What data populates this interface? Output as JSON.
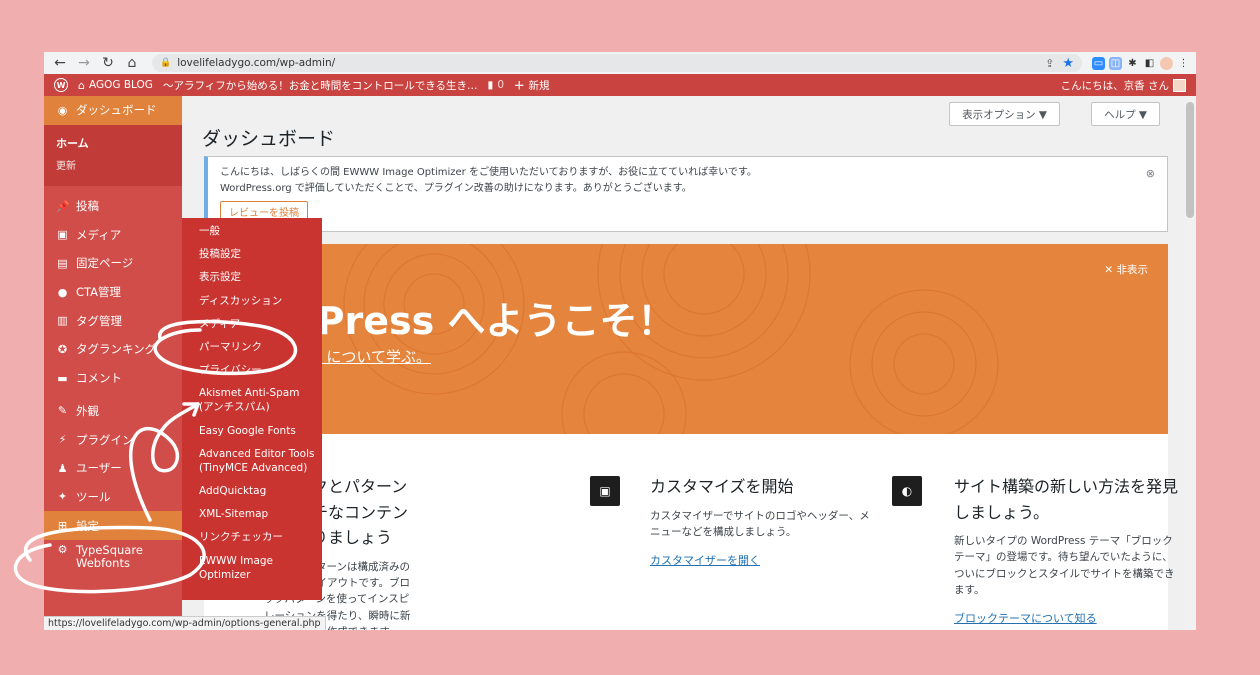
{
  "browser": {
    "url": "lovelifeladygo.com/wp-admin/",
    "status_url": "https://lovelifeladygo.com/wp-admin/options-general.php"
  },
  "adminbar": {
    "site_name": "AGOG BLOG",
    "tagline": "〜アラフィフから始める！お金と時間をコントロールできる生き…",
    "comments_count": "0",
    "new_label": "新規",
    "greeting": "こんにちは、京香 さん"
  },
  "sidebar": {
    "dashboard": "ダッシュボード",
    "home": "ホーム",
    "updates": "更新",
    "items": [
      {
        "label": "投稿",
        "icon": "pin-icon"
      },
      {
        "label": "メディア",
        "icon": "media-icon"
      },
      {
        "label": "固定ページ",
        "icon": "page-icon"
      },
      {
        "label": "CTA管理",
        "icon": "bulb-icon"
      },
      {
        "label": "タグ管理",
        "icon": "tag-frame-icon"
      },
      {
        "label": "タグランキング",
        "icon": "ribbon-icon"
      },
      {
        "label": "コメント",
        "icon": "comment-icon"
      },
      {
        "label": "外観",
        "icon": "brush-icon"
      },
      {
        "label": "プラグイン",
        "icon": "plug-icon"
      },
      {
        "label": "ユーザー",
        "icon": "user-icon"
      },
      {
        "label": "ツール",
        "icon": "wrench-icon"
      },
      {
        "label": "設定",
        "icon": "settings-icon"
      },
      {
        "label": "TypeSquare Webfonts",
        "icon": "gear-icon"
      }
    ]
  },
  "flyout": {
    "items": [
      "一般",
      "投稿設定",
      "表示設定",
      "ディスカッション",
      "メディア",
      "パーマリンク",
      "プライバシー",
      "Akismet Anti-Spam (アンチスパム)",
      "Easy Google Fonts",
      "Advanced Editor Tools (TinyMCE Advanced)",
      "AddQuicktag",
      "XML-Sitemap",
      "リンクチェッカー",
      "EWWW Image Optimizer"
    ]
  },
  "content": {
    "title": "ダッシュボード",
    "screen_options": "表示オプション ▼",
    "help": "ヘルプ ▼",
    "notice": {
      "line1": "こんにちは、しばらくの間 EWWW Image Optimizer をご使用いただいておりますが、お役に立てていれば幸いです。",
      "line2": "WordPress.org で評価していただくことで、プラグイン改善の助けになります。ありがとうございます。",
      "button": "レビューを投稿"
    },
    "welcome": {
      "title": "WordPress へようこそ！",
      "link": "バージョン 6.1.1 について学ぶ。",
      "dismiss": "✕ 非表示"
    },
    "col1": {
      "heading": "ブロックとパターンでリッチなコンテンツを作りましょう",
      "body": "ブロックパターンは構成済みのブロックレイアウトです。ブロックパターンを使ってインスピレーションを得たり、瞬時に新しいページを作成できます。"
    },
    "col2": {
      "heading": "カスタマイズを開始",
      "body": "カスタマイザーでサイトのロゴやヘッダー、メニューなどを構成しましょう。",
      "link": "カスタマイザーを開く"
    },
    "col3": {
      "heading": "サイト構築の新しい方法を発見しましょう。",
      "body": "新しいタイプの WordPress テーマ「ブロックテーマ」の登場です。待ち望んでいたように、ついにブロックとスタイルでサイトを構築できます。",
      "link": "ブロックテーマについて知る"
    }
  },
  "colors": {
    "background": "#f0aeae",
    "sidebar": "#d04d49",
    "accent": "#e0823c",
    "welcome": "#e5843d",
    "flyout": "#c93431"
  }
}
